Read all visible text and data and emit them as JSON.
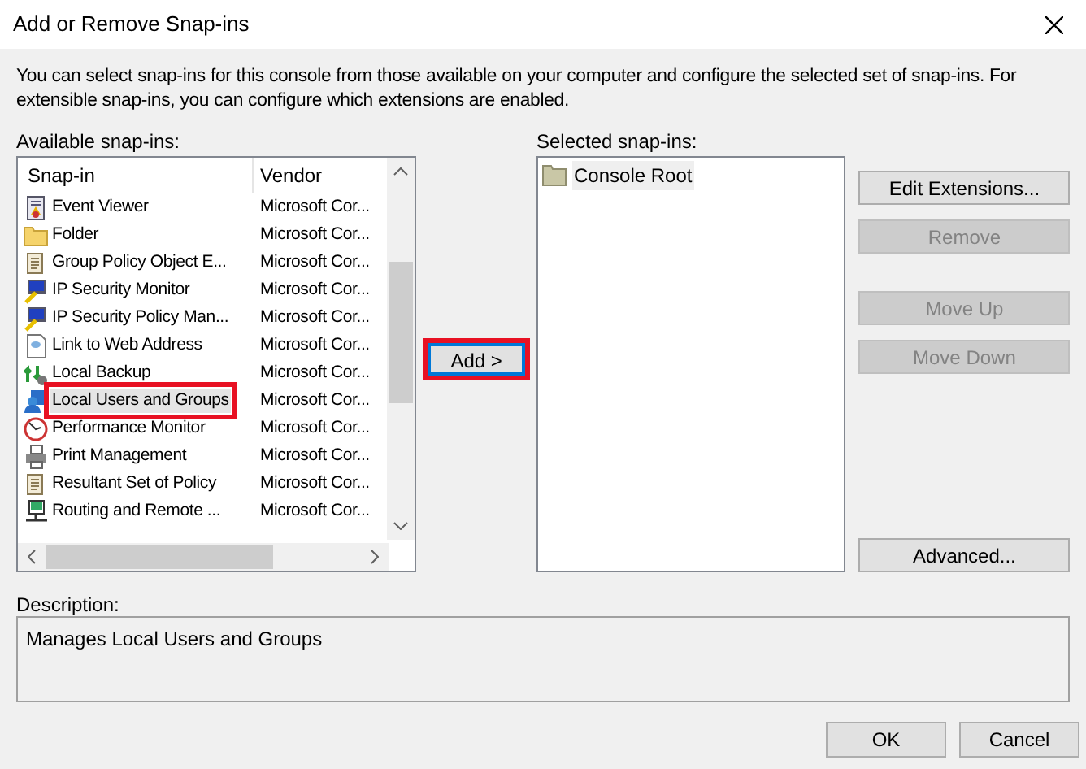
{
  "window": {
    "title": "Add or Remove Snap-ins"
  },
  "intro": "You can select snap-ins for this console from those available on your computer and configure the selected set of snap-ins. For extensible snap-ins, you can configure which extensions are enabled.",
  "available": {
    "label": "Available snap-ins:",
    "columns": [
      "Snap-in",
      "Vendor"
    ],
    "rows": [
      {
        "name": "Event Viewer",
        "vendor": "Microsoft Cor...",
        "selected": false,
        "highlighted": false
      },
      {
        "name": "Folder",
        "vendor": "Microsoft Cor...",
        "selected": false,
        "highlighted": false
      },
      {
        "name": "Group Policy Object E...",
        "vendor": "Microsoft Cor...",
        "selected": false,
        "highlighted": false
      },
      {
        "name": "IP Security Monitor",
        "vendor": "Microsoft Cor...",
        "selected": false,
        "highlighted": false
      },
      {
        "name": "IP Security Policy Man...",
        "vendor": "Microsoft Cor...",
        "selected": false,
        "highlighted": false
      },
      {
        "name": "Link to Web Address",
        "vendor": "Microsoft Cor...",
        "selected": false,
        "highlighted": false
      },
      {
        "name": "Local Backup",
        "vendor": "Microsoft Cor...",
        "selected": false,
        "highlighted": false
      },
      {
        "name": "Local Users and Groups",
        "vendor": "Microsoft Cor...",
        "selected": true,
        "highlighted": true
      },
      {
        "name": "Performance Monitor",
        "vendor": "Microsoft Cor...",
        "selected": false,
        "highlighted": false
      },
      {
        "name": "Print Management",
        "vendor": "Microsoft Cor...",
        "selected": false,
        "highlighted": false
      },
      {
        "name": "Resultant Set of Policy",
        "vendor": "Microsoft Cor...",
        "selected": false,
        "highlighted": false
      },
      {
        "name": "Routing and Remote ...",
        "vendor": "Microsoft Cor...",
        "selected": false,
        "highlighted": false
      }
    ]
  },
  "add_button": {
    "label": "Add >",
    "highlighted": true
  },
  "selected": {
    "label": "Selected snap-ins:",
    "items": [
      {
        "name": "Console Root",
        "selected": true
      }
    ]
  },
  "side_buttons": [
    {
      "label": "Edit Extensions...",
      "disabled": false
    },
    {
      "label": "Remove",
      "disabled": true
    },
    {
      "label": "Move Up",
      "disabled": true
    },
    {
      "label": "Move Down",
      "disabled": true
    },
    {
      "label": "Advanced...",
      "disabled": false
    }
  ],
  "description": {
    "label": "Description:",
    "text": "Manages Local Users and Groups"
  },
  "buttons": [
    "OK",
    "Cancel"
  ]
}
